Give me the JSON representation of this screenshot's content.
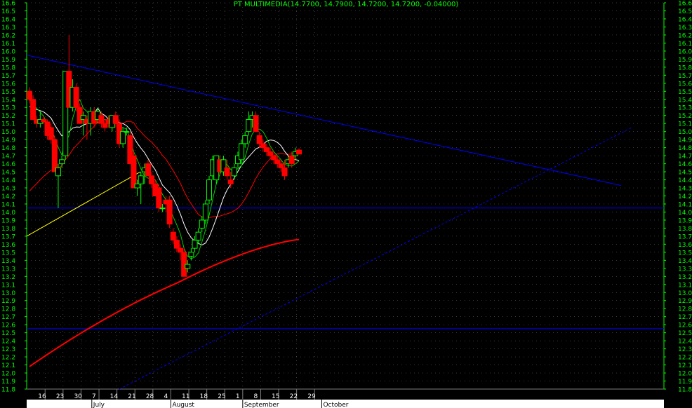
{
  "chart_data": {
    "type": "candlestick",
    "title": "PT MULTIMEDIA(14.7700, 14.7900, 14.7200, 14.7200, -0.04000)",
    "ylim": [
      11.8,
      16.6
    ],
    "y_ticks": [
      11.8,
      11.9,
      12.0,
      12.1,
      12.2,
      12.3,
      12.4,
      12.5,
      12.6,
      12.7,
      12.8,
      12.9,
      13.0,
      13.1,
      13.2,
      13.3,
      13.4,
      13.5,
      13.6,
      13.7,
      13.8,
      13.9,
      14.0,
      14.1,
      14.2,
      14.3,
      14.4,
      14.5,
      14.6,
      14.7,
      14.8,
      14.9,
      15.0,
      15.1,
      15.2,
      15.3,
      15.4,
      15.5,
      15.6,
      15.7,
      15.8,
      15.9,
      16.0,
      16.1,
      16.2,
      16.3,
      16.4,
      16.5,
      16.6
    ],
    "x_ticks": [
      {
        "label": "16",
        "i": 2
      },
      {
        "label": "23",
        "i": 7
      },
      {
        "label": "30",
        "i": 12
      },
      {
        "label": "7",
        "i": 17
      },
      {
        "label": "14",
        "i": 22
      },
      {
        "label": "21",
        "i": 27
      },
      {
        "label": "28",
        "i": 32
      },
      {
        "label": "4",
        "i": 37
      },
      {
        "label": "11",
        "i": 42
      },
      {
        "label": "18",
        "i": 47
      },
      {
        "label": "25",
        "i": 52
      },
      {
        "label": "1",
        "i": 57
      },
      {
        "label": "8",
        "i": 62
      },
      {
        "label": "15",
        "i": 67
      },
      {
        "label": "22",
        "i": 72
      },
      {
        "label": "29",
        "i": 77
      }
    ],
    "month_labels": [
      {
        "label": "July",
        "i": 15
      },
      {
        "label": "August",
        "i": 37
      },
      {
        "label": "September",
        "i": 57
      },
      {
        "label": "October",
        "i": 79
      }
    ],
    "grid": true,
    "candles": [
      [
        15.5,
        15.55,
        15.35,
        15.4
      ],
      [
        15.4,
        15.45,
        15.15,
        15.15
      ],
      [
        15.15,
        15.2,
        15.05,
        15.1
      ],
      [
        15.1,
        15.25,
        15.05,
        15.15
      ],
      [
        15.15,
        15.2,
        15.1,
        15.12
      ],
      [
        15.12,
        15.15,
        14.9,
        14.95
      ],
      [
        15.05,
        15.1,
        14.85,
        14.9
      ],
      [
        14.9,
        14.95,
        14.5,
        14.5
      ],
      [
        14.45,
        14.6,
        14.05,
        14.55
      ],
      [
        14.6,
        14.7,
        14.55,
        14.65
      ],
      [
        14.7,
        15.75,
        14.65,
        15.75
      ],
      [
        15.75,
        16.2,
        15.3,
        15.3
      ],
      [
        15.3,
        15.65,
        15.25,
        15.55
      ],
      [
        15.55,
        15.6,
        15.25,
        15.3
      ],
      [
        15.3,
        15.35,
        15.1,
        15.1
      ],
      [
        15.15,
        15.25,
        14.95,
        15.2
      ],
      [
        15.15,
        15.2,
        14.9,
        15.1
      ],
      [
        15.1,
        15.3,
        14.95,
        15.25
      ],
      [
        15.25,
        15.3,
        15.05,
        15.1
      ],
      [
        15.15,
        15.3,
        15.1,
        15.25
      ],
      [
        15.2,
        15.25,
        15.05,
        15.1
      ],
      [
        15.1,
        15.15,
        15.0,
        15.05
      ],
      [
        15.15,
        15.2,
        15.05,
        15.1
      ],
      [
        15.05,
        15.2,
        15.0,
        15.2
      ],
      [
        15.2,
        15.25,
        15.05,
        15.1
      ],
      [
        15.1,
        15.15,
        14.8,
        14.85
      ],
      [
        14.85,
        15.05,
        14.8,
        15.0
      ],
      [
        15.0,
        15.05,
        14.95,
        15.0
      ],
      [
        14.95,
        15.0,
        14.6,
        14.6
      ],
      [
        14.7,
        14.75,
        14.3,
        14.3
      ],
      [
        14.3,
        14.4,
        14.2,
        14.35
      ],
      [
        14.35,
        14.5,
        14.1,
        14.45
      ],
      [
        14.5,
        14.6,
        14.35,
        14.55
      ],
      [
        14.6,
        14.65,
        14.45,
        14.45
      ],
      [
        14.45,
        14.5,
        14.3,
        14.35
      ],
      [
        14.35,
        14.4,
        14.2,
        14.2
      ],
      [
        14.3,
        14.35,
        14.0,
        14.05
      ],
      [
        14.05,
        14.1,
        14.0,
        14.05
      ],
      [
        14.15,
        14.2,
        14.0,
        14.1
      ],
      [
        14.15,
        14.2,
        13.8,
        13.85
      ],
      [
        13.75,
        13.8,
        13.6,
        13.65
      ],
      [
        13.65,
        13.7,
        13.5,
        13.55
      ],
      [
        13.55,
        13.6,
        13.4,
        13.5
      ],
      [
        13.5,
        13.55,
        13.2,
        13.2
      ],
      [
        13.3,
        13.4,
        13.25,
        13.35
      ],
      [
        13.45,
        13.55,
        13.4,
        13.5
      ],
      [
        13.55,
        13.7,
        13.5,
        13.65
      ],
      [
        13.65,
        13.8,
        13.6,
        13.75
      ],
      [
        13.8,
        13.95,
        13.75,
        13.9
      ],
      [
        13.9,
        14.15,
        13.85,
        14.1
      ],
      [
        14.15,
        14.45,
        14.1,
        14.4
      ],
      [
        14.45,
        14.7,
        14.4,
        14.65
      ],
      [
        14.4,
        14.7,
        14.35,
        14.7
      ],
      [
        14.65,
        14.7,
        14.45,
        14.5
      ],
      [
        14.5,
        14.7,
        14.45,
        14.65
      ],
      [
        14.55,
        14.65,
        14.4,
        14.45
      ],
      [
        14.4,
        14.5,
        14.3,
        14.35
      ],
      [
        14.45,
        14.6,
        14.4,
        14.55
      ],
      [
        14.6,
        14.75,
        14.55,
        14.7
      ],
      [
        14.65,
        14.9,
        14.6,
        14.85
      ],
      [
        14.85,
        15.0,
        14.8,
        14.95
      ],
      [
        15.0,
        15.25,
        14.95,
        15.15
      ],
      [
        15.15,
        15.25,
        15.05,
        15.2
      ],
      [
        15.2,
        15.25,
        15.0,
        15.0
      ],
      [
        14.95,
        15.0,
        14.8,
        14.85
      ],
      [
        14.85,
        14.9,
        14.75,
        14.8
      ],
      [
        14.8,
        14.85,
        14.7,
        14.75
      ],
      [
        14.75,
        14.8,
        14.65,
        14.7
      ],
      [
        14.7,
        14.75,
        14.6,
        14.65
      ],
      [
        14.65,
        14.7,
        14.55,
        14.6
      ],
      [
        14.6,
        14.65,
        14.5,
        14.55
      ],
      [
        14.55,
        14.65,
        14.4,
        14.45
      ],
      [
        14.6,
        14.7,
        14.55,
        14.65
      ],
      [
        14.7,
        14.75,
        14.55,
        14.6
      ],
      [
        14.7,
        14.8,
        14.65,
        14.75
      ],
      [
        14.77,
        14.79,
        14.72,
        14.72
      ]
    ],
    "hlines": [
      14.05,
      12.55
    ],
    "colors": {
      "up": "#00ff00",
      "down": "#ff0000",
      "grid": "#ffffff",
      "axis": "#00ff00",
      "trend": "#0000ff",
      "hline": "#0000ff",
      "ma_short": "#ffffff",
      "ma_green": "#00cc00",
      "ma_mid": "#ff0000",
      "ma_long": "#ff0000",
      "yellow": "#ffff00",
      "background": "#000000"
    }
  }
}
